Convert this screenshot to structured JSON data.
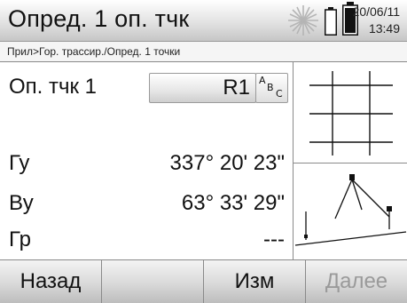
{
  "titlebar": {
    "title": "Опред. 1 оп. тчк",
    "date": "20/06/11",
    "time": "13:49"
  },
  "breadcrumb": "Прил>Гор. трассир./Опред. 1 точки",
  "fields": {
    "point_label": "Оп. тчк 1",
    "point_value": "R1",
    "hz_label": "Гу",
    "hz_value": "337° 20' 23\"",
    "v_label": "Ву",
    "v_value": "63° 33' 29\"",
    "dist_label": "Гр",
    "dist_value": "---"
  },
  "abc_button": {
    "a": "A",
    "b": "B",
    "c": "C"
  },
  "softkeys": {
    "back": "Назад",
    "empty": "",
    "edit": "Изм",
    "next": "Далее"
  }
}
